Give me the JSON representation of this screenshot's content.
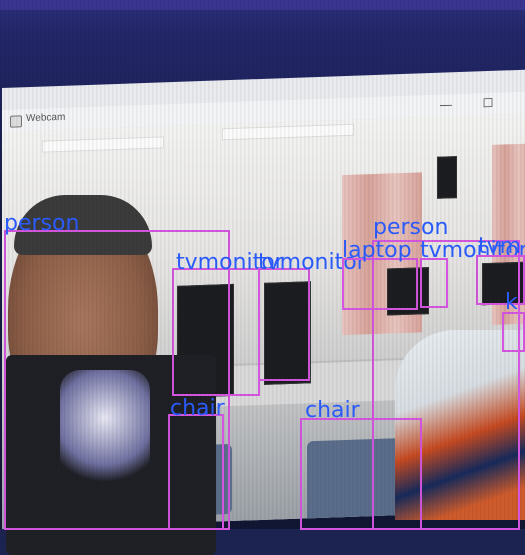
{
  "window": {
    "title": "Webcam",
    "minimize_glyph": "—",
    "maximize_glyph": "☐"
  },
  "detections": [
    {
      "label": "person"
    },
    {
      "label": "tvmonitor"
    },
    {
      "label": "tvmonitor"
    },
    {
      "label": "person"
    },
    {
      "label": "laptop"
    },
    {
      "label": "tvmonitor"
    },
    {
      "label": "tvm"
    },
    {
      "label": "k"
    },
    {
      "label": "chair"
    },
    {
      "label": "chair"
    }
  ],
  "colors": {
    "box_color": "#d456e0",
    "label_color": "#2b5cff"
  }
}
